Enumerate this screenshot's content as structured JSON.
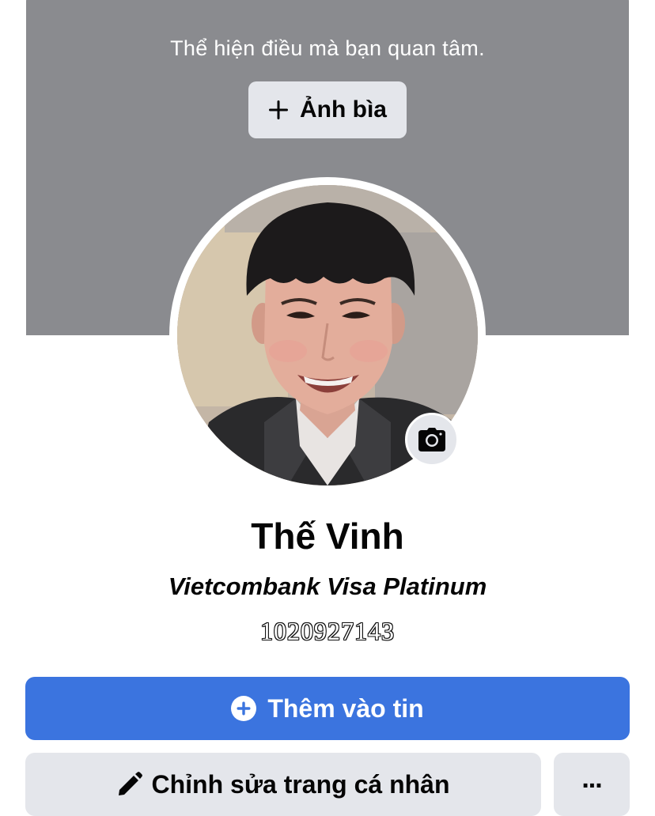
{
  "cover": {
    "hint": "Thể hiện điều mà bạn quan tâm.",
    "add_cover_label": "Ảnh bìa",
    "add_cover_icon": "plus-icon",
    "background_color": "#8a8b8f"
  },
  "profile": {
    "name": "Thế Vinh",
    "bio_line1": "Vietcombank Visa Platinum",
    "bio_line2": "1020927143",
    "avatar_icon": "profile-photo",
    "camera_icon": "camera-icon"
  },
  "actions": {
    "add_story_label": "Thêm vào tin",
    "add_story_icon": "plus-circle-icon",
    "add_story_color": "#3b74df",
    "edit_profile_label": "Chỉnh sửa trang cá nhân",
    "edit_profile_icon": "pencil-icon",
    "more_label": "...",
    "more_icon": "ellipsis-icon"
  }
}
